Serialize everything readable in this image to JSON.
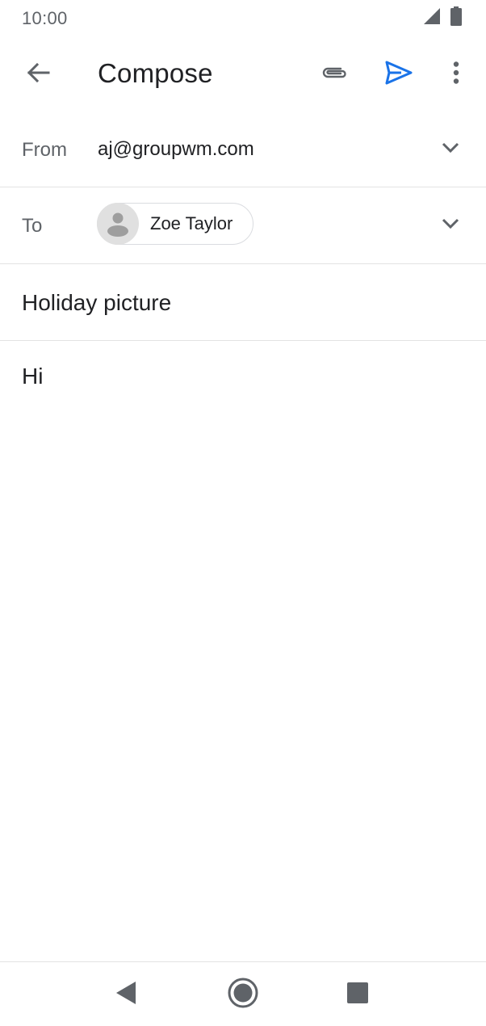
{
  "status_bar": {
    "time": "10:00",
    "icons": [
      "signal-icon",
      "battery-icon"
    ]
  },
  "app_bar": {
    "title": "Compose",
    "icons": [
      "back-arrow-icon",
      "attachment-icon",
      "send-icon",
      "more-vert-icon"
    ]
  },
  "form": {
    "from_label": "From",
    "from_value": "aj@groupwm.com",
    "to_label": "To",
    "recipients": [
      {
        "name": "Zoe Taylor",
        "icon": "person-avatar-icon"
      }
    ],
    "subject": "Holiday picture",
    "body": "Hi"
  },
  "nav_bar": {
    "icons": [
      "nav-back-icon",
      "nav-home-icon",
      "nav-recents-icon"
    ]
  },
  "colors": {
    "accent": "#1a73e8",
    "text_primary": "#202124",
    "text_secondary": "#5f6368",
    "divider": "#e3e3e3",
    "avatar_bg": "#e0e0e0"
  }
}
